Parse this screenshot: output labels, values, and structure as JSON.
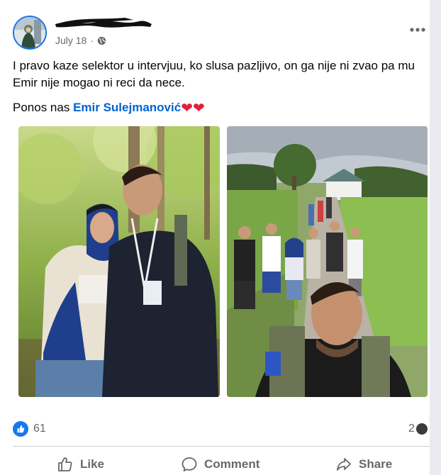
{
  "post": {
    "author_name": "",
    "date": "July 18",
    "dot": "·",
    "privacy_icon": "globe-icon",
    "text_line1": "I pravo kaze selektor u intervjuu, ko slusa pazljivo, on ga nije ni zvao pa mu Emir nije mogao ni reci da nece.",
    "text_prefix": "Ponos nas ",
    "mention": "Emir Sulejmanović",
    "hearts": "❤️❤️"
  },
  "photos": [
    {
      "description_icon": "photo-left-image"
    },
    {
      "description_icon": "photo-right-image"
    }
  ],
  "stats": {
    "like_count": "61",
    "comment_count": "2"
  },
  "actions": {
    "like_label": "Like",
    "comment_label": "Comment",
    "share_label": "Share"
  },
  "colors": {
    "accent": "#1877f2",
    "mention": "#0064d1",
    "secondary_text": "#65676b",
    "heart": "#e41e3f"
  }
}
